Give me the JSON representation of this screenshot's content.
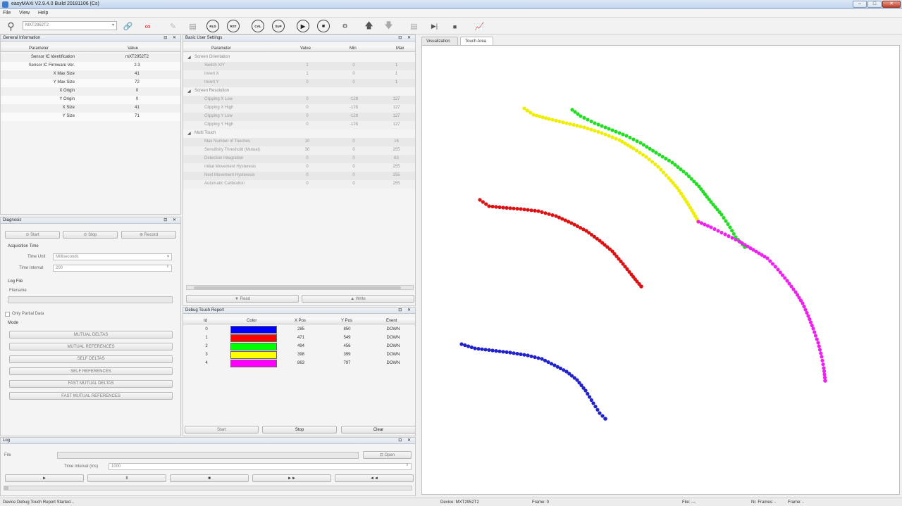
{
  "window": {
    "title": "easyMAXi V2.9.4.0 Build 20181106 (Cs)",
    "min": "–",
    "max": "□",
    "close": "✕"
  },
  "menu": [
    "File",
    "View",
    "Help"
  ],
  "toolbar": {
    "device": "MXT2952T2",
    "circle_buttons": [
      "RLD",
      "RST",
      "CAL",
      "SUP"
    ]
  },
  "general_info": {
    "title": "General Information",
    "columns": [
      "Parameter",
      "Value"
    ],
    "rows": [
      [
        "Sensor IC Identification",
        "mXT2952T2"
      ],
      [
        "Sensor IC Firmware Ver.",
        "2.3"
      ],
      [
        "X Max Size",
        "41"
      ],
      [
        "Y Max Size",
        "72"
      ],
      [
        "X Origin",
        "0"
      ],
      [
        "Y Origin",
        "0"
      ],
      [
        "X Size",
        "41"
      ],
      [
        "Y Size",
        "71"
      ]
    ]
  },
  "basic_settings": {
    "title": "Basic User Settings",
    "columns": [
      "Parameter",
      "Value",
      "Min",
      "Max"
    ],
    "groups": [
      {
        "name": "Screen Orientation",
        "rows": [
          [
            "Switch X/Y",
            "1",
            "0",
            "1"
          ],
          [
            "Invert X",
            "1",
            "0",
            "1"
          ],
          [
            "Invert Y",
            "0",
            "0",
            "1"
          ]
        ]
      },
      {
        "name": "Screen Resolution",
        "rows": [
          [
            "Clipping X Low",
            "0",
            "-128",
            "127"
          ],
          [
            "Clipping X High",
            "0",
            "-128",
            "127"
          ],
          [
            "Clipping Y Low",
            "0",
            "-128",
            "127"
          ],
          [
            "Clipping Y High",
            "0",
            "-128",
            "127"
          ]
        ]
      },
      {
        "name": "Multi Touch",
        "rows": [
          [
            "Max Number of Touches",
            "10",
            "0",
            "16"
          ],
          [
            "Sensitivity Threshold (Mutual)",
            "30",
            "0",
            "255"
          ],
          [
            "Detection Integration",
            "0",
            "0",
            "63"
          ],
          [
            "Initial Movement Hysteresis",
            "0",
            "0",
            "255"
          ],
          [
            "Next Movement Hysteresis",
            "0",
            "0",
            "255"
          ],
          [
            "Automatic Calibration",
            "0",
            "0",
            "255"
          ]
        ]
      }
    ],
    "read": "Read",
    "write": "Write"
  },
  "diagnosis": {
    "title": "Diagnosis",
    "start": "Start",
    "stop": "Stop",
    "record": "Record",
    "acq_title": "Acquisition Time",
    "time_unit_label": "Time Unit",
    "time_unit": "Milliseconds",
    "time_interval_label": "Time Interval",
    "time_interval": "200",
    "logfile_title": "Log File",
    "filename_label": "Filename",
    "only_partial": "Only Partial Data",
    "mode_label": "Mode",
    "modes": [
      "MUTUAL DELTAS",
      "MUTUAL REFERENCES",
      "SELF DELTAS",
      "SELF REFERENCES",
      "FAST MUTUAL DELTAS",
      "FAST MUTUAL REFERENCES"
    ]
  },
  "debug_report": {
    "title": "Debug Touch Report",
    "columns": [
      "Id",
      "Color",
      "X Pos",
      "Y Pos",
      "Event"
    ],
    "rows": [
      {
        "id": "0",
        "color": "#0000ff",
        "x": "285",
        "y": "850",
        "event": "DOWN"
      },
      {
        "id": "1",
        "color": "#ff0000",
        "x": "471",
        "y": "549",
        "event": "DOWN"
      },
      {
        "id": "2",
        "color": "#00ff00",
        "x": "494",
        "y": "456",
        "event": "DOWN"
      },
      {
        "id": "3",
        "color": "#ffff00",
        "x": "398",
        "y": "399",
        "event": "DOWN"
      },
      {
        "id": "4",
        "color": "#ff00ff",
        "x": "863",
        "y": "797",
        "event": "DOWN"
      }
    ],
    "start": "Start",
    "stop": "Stop",
    "clear": "Clear"
  },
  "log": {
    "title": "Log",
    "file_label": "File",
    "open": "Open",
    "interval_label": "Time Interval (ms)",
    "interval": "1000",
    "controls": [
      "►",
      "II",
      "■",
      "►►",
      "◄◄"
    ]
  },
  "tabs": [
    "Visualization",
    "Touch Area"
  ],
  "status": {
    "left": "Device Debug Touch Report Started...",
    "device": "Device: MXT2952T2",
    "frame": "Frame: 0",
    "file": "File: ---",
    "nr_frames": "Nr. Frames: -",
    "frame2": "Frame: -"
  },
  "traces": [
    {
      "color": "#2222cc",
      "points": [
        [
          56,
          424
        ],
        [
          75,
          430
        ],
        [
          100,
          433
        ],
        [
          125,
          436
        ],
        [
          150,
          440
        ],
        [
          170,
          445
        ],
        [
          188,
          454
        ],
        [
          205,
          463
        ],
        [
          220,
          475
        ],
        [
          232,
          490
        ],
        [
          243,
          508
        ],
        [
          252,
          522
        ],
        [
          260,
          530
        ]
      ]
    },
    {
      "color": "#dd1111",
      "points": [
        [
          82,
          219
        ],
        [
          95,
          228
        ],
        [
          115,
          230
        ],
        [
          140,
          232
        ],
        [
          165,
          235
        ],
        [
          190,
          242
        ],
        [
          212,
          252
        ],
        [
          233,
          263
        ],
        [
          252,
          277
        ],
        [
          270,
          292
        ],
        [
          285,
          310
        ],
        [
          297,
          325
        ],
        [
          305,
          335
        ],
        [
          311,
          342
        ]
      ]
    },
    {
      "color": "#22dd22",
      "points": [
        [
          213,
          91
        ],
        [
          225,
          100
        ],
        [
          245,
          110
        ],
        [
          265,
          118
        ],
        [
          290,
          128
        ],
        [
          310,
          138
        ],
        [
          332,
          152
        ],
        [
          355,
          166
        ],
        [
          375,
          182
        ],
        [
          393,
          200
        ],
        [
          410,
          222
        ],
        [
          425,
          240
        ],
        [
          437,
          258
        ],
        [
          445,
          272
        ],
        [
          458,
          286
        ]
      ]
    },
    {
      "color": "#eeee00",
      "points": [
        [
          145,
          89
        ],
        [
          158,
          98
        ],
        [
          180,
          104
        ],
        [
          205,
          110
        ],
        [
          230,
          116
        ],
        [
          255,
          124
        ],
        [
          280,
          134
        ],
        [
          300,
          146
        ],
        [
          318,
          158
        ],
        [
          335,
          172
        ],
        [
          350,
          188
        ],
        [
          362,
          202
        ],
        [
          373,
          218
        ],
        [
          383,
          234
        ],
        [
          392,
          250
        ]
      ]
    },
    {
      "color": "#ee22ee",
      "points": [
        [
          392,
          250
        ],
        [
          410,
          258
        ],
        [
          430,
          268
        ],
        [
          450,
          278
        ],
        [
          470,
          290
        ],
        [
          490,
          302
        ],
        [
          505,
          318
        ],
        [
          518,
          334
        ],
        [
          530,
          350
        ],
        [
          540,
          366
        ],
        [
          548,
          384
        ],
        [
          555,
          402
        ],
        [
          562,
          422
        ],
        [
          567,
          442
        ],
        [
          570,
          458
        ],
        [
          572,
          476
        ]
      ]
    }
  ]
}
